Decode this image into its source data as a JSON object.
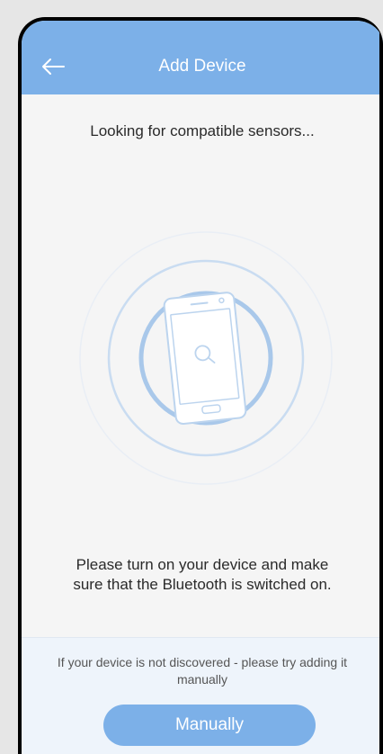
{
  "header": {
    "title": "Add Device",
    "back_icon": "arrow-left-icon"
  },
  "main": {
    "status_text": "Looking for compatible sensors...",
    "illustration_icon": "phone-search-icon",
    "instruction_text": "Please turn on your device and make sure that the Bluetooth is switched on."
  },
  "footer": {
    "hint_text": "If your device is not discovered - please try adding it manually",
    "manual_button_label": "Manually"
  },
  "colors": {
    "accent": "#7cb0e8",
    "background": "#f5f5f5",
    "footer_background": "#eef4fb"
  }
}
